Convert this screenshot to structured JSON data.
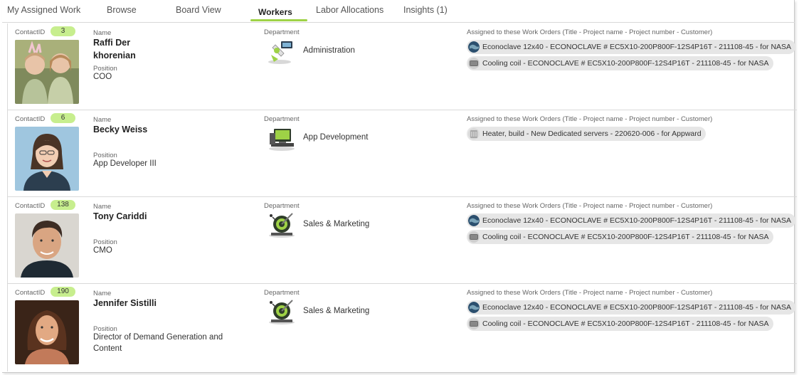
{
  "tabs": [
    {
      "label": "My Assigned Work"
    },
    {
      "label": "Browse"
    },
    {
      "label": "Board View"
    },
    {
      "label": "Workers"
    },
    {
      "label": "Labor Allocations"
    },
    {
      "label": "Insights (1)"
    }
  ],
  "active_tab": "Workers",
  "colors": {
    "accent": "#9ed246",
    "badge": "#c7ee8e",
    "pill": "#e6e6e6"
  },
  "field_labels": {
    "contact_id": "ContactID",
    "name": "Name",
    "position": "Position",
    "department": "Department",
    "work_orders": "Assigned to these Work Orders (Title - Project name - Project number - Customer)"
  },
  "workers": [
    {
      "contact_id": "3",
      "name": "Raffi Der khorenian",
      "position": "COO",
      "department": "Administration",
      "department_icon": "administration-icon",
      "work_orders": [
        {
          "text": "Econoclave 12x40 - ECONOCLAVE # EC5X10-200P800F-12S4P16T - 211108-45 - for NASA",
          "icon": "globe-icon"
        },
        {
          "text": "Cooling coil - ECONOCLAVE # EC5X10-200P800F-12S4P16T - 211108-45 - for NASA",
          "icon": "coil-icon"
        }
      ]
    },
    {
      "contact_id": "6",
      "name": "Becky Weiss",
      "position": "App Developer III",
      "department": "App Development",
      "department_icon": "computer-icon",
      "work_orders": [
        {
          "text": "Heater, build - New Dedicated servers - 220620-006 - for Appward",
          "icon": "heater-icon"
        }
      ]
    },
    {
      "contact_id": "138",
      "name": "Tony Cariddi",
      "position": "CMO",
      "department": "Sales & Marketing",
      "department_icon": "target-icon",
      "work_orders": [
        {
          "text": "Econoclave 12x40 - ECONOCLAVE # EC5X10-200P800F-12S4P16T - 211108-45 - for NASA",
          "icon": "globe-icon"
        },
        {
          "text": "Cooling coil - ECONOCLAVE # EC5X10-200P800F-12S4P16T - 211108-45 - for NASA",
          "icon": "coil-icon"
        }
      ]
    },
    {
      "contact_id": "190",
      "name": "Jennifer Sistilli",
      "position": "Director of Demand Generation and Content",
      "department": "Sales & Marketing",
      "department_icon": "target-icon",
      "work_orders": [
        {
          "text": "Econoclave 12x40 - ECONOCLAVE # EC5X10-200P800F-12S4P16T - 211108-45 - for NASA",
          "icon": "globe-icon"
        },
        {
          "text": "Cooling coil - ECONOCLAVE # EC5X10-200P800F-12S4P16T - 211108-45 - for NASA",
          "icon": "coil-icon"
        }
      ]
    }
  ]
}
